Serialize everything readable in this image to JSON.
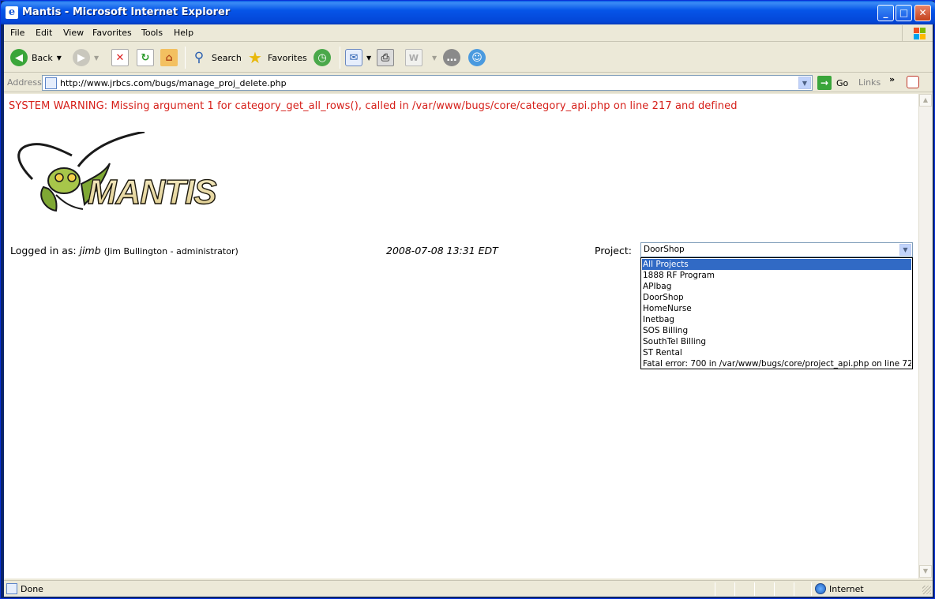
{
  "window": {
    "title": "Mantis - Microsoft Internet Explorer",
    "controls": {
      "minimize": "_",
      "maximize": "□",
      "close": "✕"
    }
  },
  "menubar": {
    "items": [
      "File",
      "Edit",
      "View",
      "Favorites",
      "Tools",
      "Help"
    ]
  },
  "toolbar": {
    "back_label": "Back",
    "search_label": "Search",
    "favorites_label": "Favorites"
  },
  "addressbar": {
    "label": "Address",
    "url": "http://www.jrbcs.com/bugs/manage_proj_delete.php",
    "go_label": "Go",
    "links_label": "Links",
    "links_chevron": "»"
  },
  "page": {
    "warning": "SYSTEM WARNING: Missing argument 1 for category_get_all_rows(), called in /var/www/bugs/core/category_api.php on line 217 and defined",
    "logo_text": "MANTIS",
    "logged_in_label": "Logged in as:",
    "username": "jimb",
    "user_fullname": "(Jim Bullington - administrator)",
    "datetime": "2008-07-08 13:31 EDT",
    "project_label": "Project:",
    "project_selected": "DoorShop",
    "project_options": [
      "All Projects",
      "1888 RF Program",
      "APIbag",
      "DoorShop",
      "HomeNurse",
      "Inetbag",
      "SOS Billing",
      "SouthTel Billing",
      "ST Rental",
      "Fatal error: 700 in /var/www/bugs/core/project_api.php on line 72"
    ],
    "highlighted_option": "All Projects"
  },
  "statusbar": {
    "status": "Done",
    "zone": "Internet"
  },
  "colors": {
    "warning": "#d6201a",
    "selection": "#316ac5",
    "titlebar": "#0655e8"
  }
}
